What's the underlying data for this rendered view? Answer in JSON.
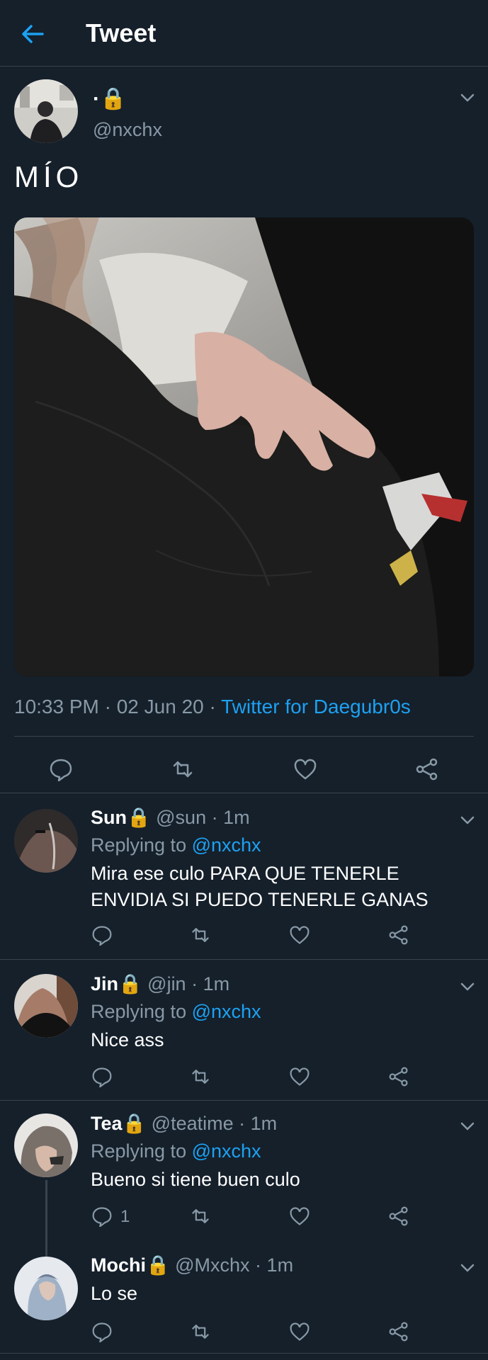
{
  "header": {
    "title": "Tweet"
  },
  "tweet": {
    "display_name": "·🔒",
    "handle": "@nxchx",
    "text": "MÍO",
    "time": "10:33 PM · 02 Jun 20 · ",
    "source": "Twitter for Daegubr0s"
  },
  "replies": [
    {
      "name": "Sun",
      "lock": "🔒",
      "handle": "@sun · 1m",
      "replying_prefix": "Replying to ",
      "replying_to": "@nxchx",
      "text": "Mira ese culo PARA QUE TENERLE ENVIDIA SI PUEDO TENERLE GANAS"
    },
    {
      "name": "Jin",
      "lock": "🔒",
      "handle": "@jin · 1m",
      "replying_prefix": "Replying to ",
      "replying_to": "@nxchx",
      "text": "Nice ass"
    },
    {
      "name": "Tea",
      "lock": "🔒",
      "handle": "@teatime · 1m",
      "replying_prefix": "Replying to ",
      "replying_to": "@nxchx",
      "text": "Bueno si tiene buen culo",
      "reply_count": "1"
    },
    {
      "name": "Mochi",
      "lock": "🔒",
      "handle": "@Mxchx · 1m",
      "text": "Lo se"
    }
  ],
  "icons": {
    "back": "arrow-left-icon",
    "more": "chevron-down-icon",
    "reply": "comment-icon",
    "retweet": "retweet-icon",
    "like": "heart-icon",
    "share": "share-icon"
  },
  "colors": {
    "background": "#15202b",
    "accent": "#1da1f2",
    "muted": "#8899a6",
    "divider": "#38444d"
  }
}
